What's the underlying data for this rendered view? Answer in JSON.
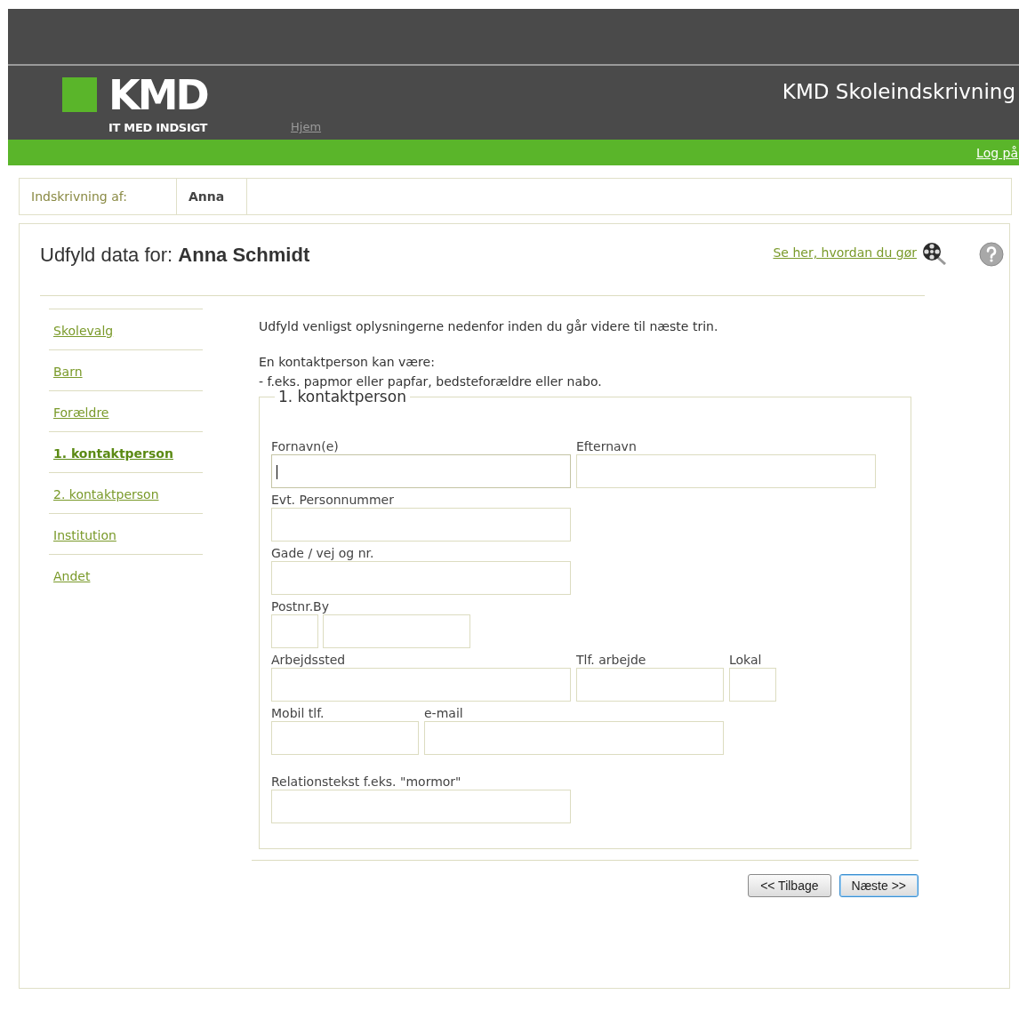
{
  "header": {
    "logo_text": "KMD",
    "logo_tagline": "IT MED INDSIGT",
    "nav_link": "Hjem",
    "app_title": "KMD Skoleindskrivning",
    "login_link": "Log på"
  },
  "enrollment": {
    "label": "Indskrivning af:",
    "child": "Anna"
  },
  "page": {
    "title_prefix": "Udfyld data for:",
    "title_name": "Anna Schmidt",
    "help_link": "Se her, hvordan du gør"
  },
  "steps": [
    {
      "label": "Skolevalg",
      "selected": false
    },
    {
      "label": "Barn",
      "selected": false
    },
    {
      "label": "Forældre",
      "selected": false
    },
    {
      "label": "1. kontaktperson",
      "selected": true
    },
    {
      "label": "2. kontaktperson",
      "selected": false
    },
    {
      "label": "Institution",
      "selected": false
    },
    {
      "label": "Andet",
      "selected": false
    }
  ],
  "intro": "Udfyld venligst oplysningerne nedenfor inden du går videre til næste trin.",
  "note_lines": [
    "En kontaktperson kan være:",
    "- f.eks. papmor eller papfar, bedsteforældre eller nabo."
  ],
  "fieldset": {
    "legend": "1. kontaktperson",
    "rows": [
      [
        {
          "label": "Fornavn(e)",
          "kind": "wide",
          "focused": true
        },
        {
          "label": "Efternavn",
          "kind": "wide",
          "focused": false
        }
      ],
      [
        {
          "label": "Evt. Personnummer",
          "kind": "wide",
          "focused": false
        }
      ],
      [
        {
          "label": "Gade / vej og nr.",
          "kind": "wide",
          "focused": false
        }
      ],
      [
        {
          "label": "Postnr.By",
          "kind": "postal",
          "focused": false
        }
      ],
      [
        {
          "label": "Arbejdssted",
          "kind": "wide",
          "focused": false
        },
        {
          "label": "Tlf. arbejde",
          "kind": "half",
          "focused": false
        },
        {
          "label": "Lokal",
          "kind": "tiny",
          "focused": false
        }
      ],
      [
        {
          "label": "Mobil tlf.",
          "kind": "half",
          "focused": false
        },
        {
          "label": "e-mail",
          "kind": "wide",
          "focused": false
        }
      ],
      [
        {
          "label": "Relationstekst f.eks. \"mormor\"",
          "kind": "wide",
          "focused": false
        }
      ]
    ]
  },
  "buttons": [
    {
      "label": "<< Tilbage",
      "primary": false
    },
    {
      "label": "Næste >>",
      "primary": true
    }
  ]
}
